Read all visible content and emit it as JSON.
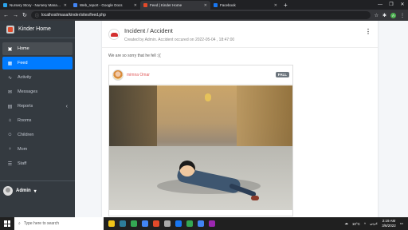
{
  "browser": {
    "tabs": [
      {
        "title": "Nursery Story - Nursery Managem...",
        "color": "#2ba3ec",
        "active": false
      },
      {
        "title": "Web_report - Google Docs",
        "color": "#4285f4",
        "active": false
      },
      {
        "title": "Feed | Kinder Home",
        "color": "#e24a2a",
        "active": true
      },
      {
        "title": "Facebook",
        "color": "#1877f2",
        "active": false
      }
    ],
    "new_tab": "+",
    "url": "localhost/masa/kinder/sites/feed.php",
    "profile_initial": "A"
  },
  "sidebar": {
    "brand": "Kinder Home",
    "items": [
      {
        "label": "Home",
        "icon": "home-icon",
        "glyph": "▣"
      },
      {
        "label": "Feed",
        "icon": "feed-icon",
        "glyph": "▦"
      },
      {
        "label": "Activity",
        "icon": "activity-icon",
        "glyph": "∿"
      },
      {
        "label": "Messages",
        "icon": "messages-icon",
        "glyph": "✉"
      },
      {
        "label": "Reports",
        "icon": "reports-icon",
        "glyph": "▤",
        "chevron": "‹"
      },
      {
        "label": "Rooms",
        "icon": "rooms-icon",
        "glyph": "⌂"
      },
      {
        "label": "Children",
        "icon": "children-icon",
        "glyph": "☺"
      },
      {
        "label": "Mom",
        "icon": "mom-icon",
        "glyph": "♀"
      },
      {
        "label": "Staff",
        "icon": "staff-icon",
        "glyph": "☰"
      }
    ],
    "user": {
      "name": "Admin",
      "caret": "▾"
    }
  },
  "post": {
    "title": "Incident / Accident",
    "meta": "Created by Admin. Accident occured on 2022-05-04 , 18:47:00",
    "menu": "⋮",
    "text": "We are so sorry that he fell :((",
    "child_name": "mimna Omar",
    "badge": "FALL"
  },
  "taskbar": {
    "search_placeholder": "Type here to search",
    "weather": "10°C",
    "lang": "عربي",
    "time": "2:19 AM",
    "date": "3/6/2022",
    "apps": [
      "#f0c419",
      "#2d7d9a",
      "#34a853",
      "#4285f4",
      "#e24a2a",
      "#aaaaaa",
      "#1877f2",
      "#34a853",
      "#4285f4",
      "#9c27b0"
    ]
  }
}
